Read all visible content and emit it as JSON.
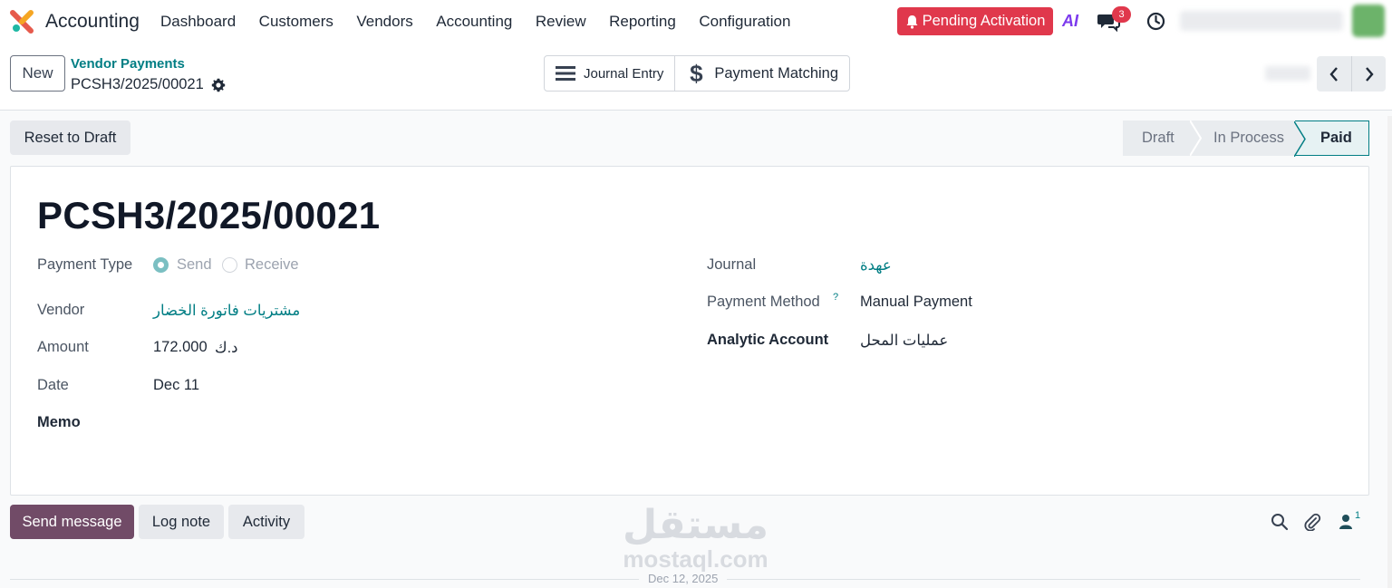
{
  "app": {
    "name": "Accounting"
  },
  "menu": [
    "Dashboard",
    "Customers",
    "Vendors",
    "Accounting",
    "Review",
    "Reporting",
    "Configuration"
  ],
  "systray": {
    "pending_label": "Pending Activation",
    "ai_label": "AI",
    "chat_badge": "3"
  },
  "control": {
    "new_label": "New",
    "breadcrumb_parent": "Vendor Payments",
    "breadcrumb_current": "PCSH3/2025/00021",
    "smart_buttons": [
      "Journal Entry",
      "Payment Matching"
    ]
  },
  "statusbar": {
    "reset_label": "Reset to Draft",
    "stages": [
      "Draft",
      "In Process",
      "Paid"
    ],
    "active_stage": "Paid"
  },
  "record": {
    "title": "PCSH3/2025/00021",
    "fields_left": {
      "payment_type_label": "Payment Type",
      "payment_type_options": [
        "Send",
        "Receive"
      ],
      "payment_type_selected": "Send",
      "vendor_label": "Vendor",
      "vendor_value": "مشتريات فاتورة الخضار",
      "amount_label": "Amount",
      "amount_value": "172.000",
      "amount_currency": "د.ك",
      "date_label": "Date",
      "date_value": "Dec 11",
      "memo_label": "Memo"
    },
    "fields_right": {
      "journal_label": "Journal",
      "journal_value": "عهدة",
      "payment_method_label": "Payment Method",
      "payment_method_help": "?",
      "payment_method_value": "Manual Payment",
      "analytic_label": "Analytic Account",
      "analytic_value": "عمليات المحل"
    }
  },
  "chatter": {
    "send_label": "Send message",
    "log_label": "Log note",
    "activity_label": "Activity",
    "followers_count": "1",
    "date_separator": "Dec 12, 2025"
  },
  "watermark": {
    "arabic": "مستقل",
    "latin": "mostaql.com"
  },
  "colors": {
    "brand_teal": "#017e84",
    "send_purple": "#714b67",
    "pending_red": "#e0384c"
  }
}
